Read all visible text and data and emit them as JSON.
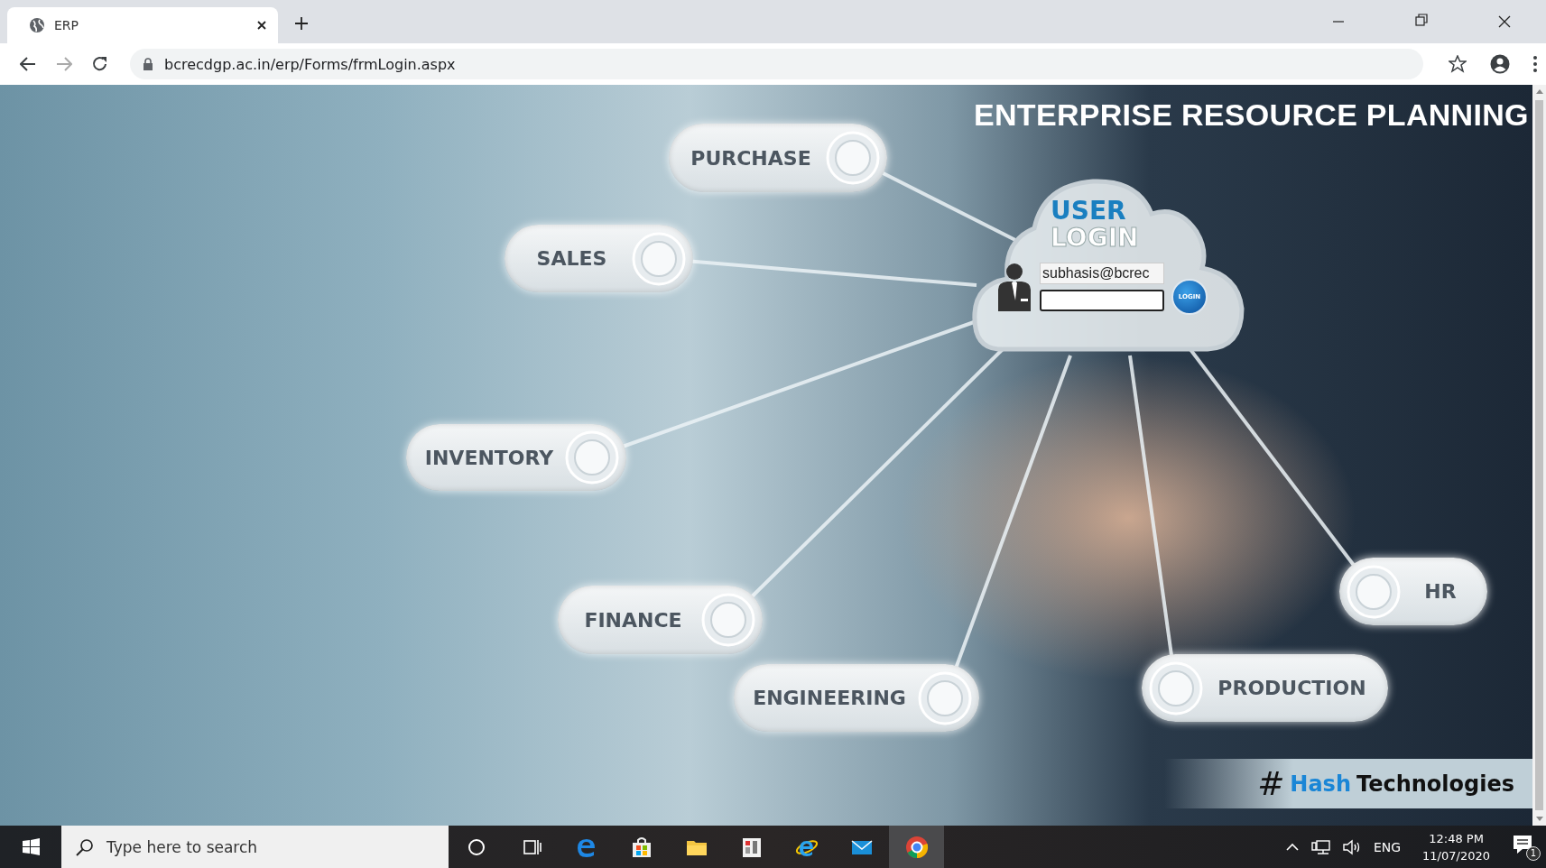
{
  "browser": {
    "tab": {
      "title": "ERP"
    },
    "address": "bcrecdgp.ac.in/erp/Forms/frmLogin.aspx"
  },
  "page": {
    "heading": "ENTERPRISE RESOURCE PLANNING",
    "modules": [
      {
        "label": "PURCHASE"
      },
      {
        "label": "SALES"
      },
      {
        "label": "INVENTORY"
      },
      {
        "label": "FINANCE"
      },
      {
        "label": "ENGINEERING"
      },
      {
        "label": "PRODUCTION"
      },
      {
        "label": "HR"
      }
    ],
    "login": {
      "title_line_1": "USER",
      "title_line_2": "LOGIN",
      "username": "subhasis@bcrec",
      "button": "LOGIN"
    },
    "brand": {
      "mark": "#",
      "name_1": "Hash",
      "name_2": "Technologies"
    }
  },
  "taskbar": {
    "search_placeholder": "Type here to search",
    "language": "ENG",
    "time": "12:48 PM",
    "date": "11/07/2020",
    "notification_count": "1"
  }
}
